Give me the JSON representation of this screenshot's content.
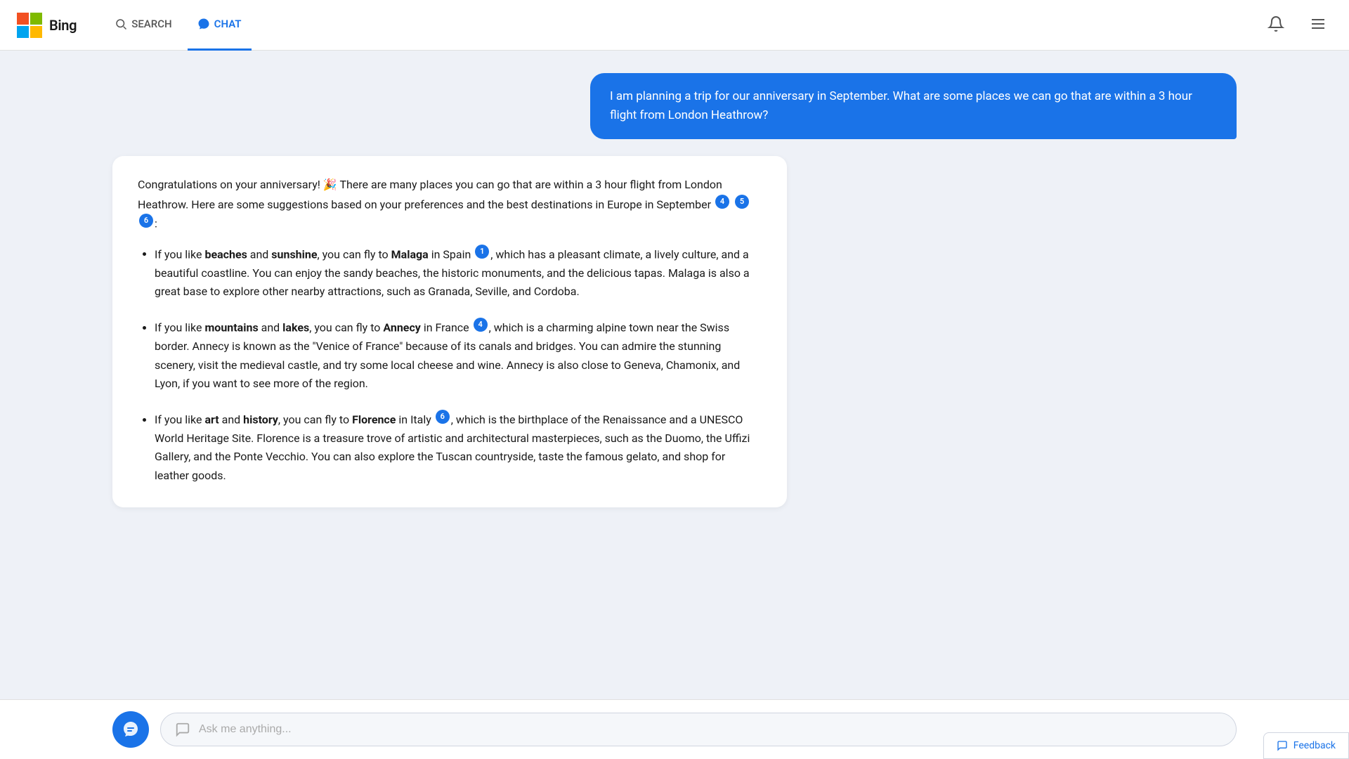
{
  "header": {
    "logo_alt": "Microsoft Bing",
    "brand_text": "Bing",
    "nav": [
      {
        "id": "search",
        "label": "SEARCH",
        "active": false
      },
      {
        "id": "chat",
        "label": "CHAT",
        "active": true
      }
    ]
  },
  "user_message": "I am planning a trip for our anniversary in September. What are some places we can go that are within a 3 hour flight from London Heathrow?",
  "ai_response": {
    "intro": "Congratulations on your anniversary! 🎉 There are many places you can go that are within a 3 hour flight from London Heathrow. Here are some suggestions based on your preferences and the best destinations in Europe in September",
    "intro_citations": [
      "4",
      "5",
      "6"
    ],
    "items": [
      {
        "text_before_bold": "If you like ",
        "bold1": "beaches",
        "text_between": " and ",
        "bold2": "sunshine",
        "text_after": ", you can fly to ",
        "bold3": "Malaga",
        "text_location": " in Spain",
        "citation": "1",
        "rest": ", which has a pleasant climate, a lively culture, and a beautiful coastline. You can enjoy the sandy beaches, the historic monuments, and the delicious tapas. Malaga is also a great base to explore other nearby attractions, such as Granada, Seville, and Cordoba."
      },
      {
        "text_before_bold": "If you like ",
        "bold1": "mountains",
        "text_between": " and ",
        "bold2": "lakes",
        "text_after": ", you can fly to ",
        "bold3": "Annecy",
        "text_location": " in France",
        "citation": "4",
        "rest": ", which is a charming alpine town near the Swiss border. Annecy is known as the “Venice of France” because of its canals and bridges. You can admire the stunning scenery, visit the medieval castle, and try some local cheese and wine. Annecy is also close to Geneva, Chamonix, and Lyon, if you want to see more of the region."
      },
      {
        "text_before_bold": "If you like ",
        "bold1": "art",
        "text_between": " and ",
        "bold2": "history",
        "text_after": ", you can fly to ",
        "bold3": "Florence",
        "text_location": " in Italy",
        "citation": "6",
        "rest": ", which is the birthplace of the Renaissance and a UNESCO World Heritage Site. Florence is a treasure trove of artistic and architectural masterpieces, such as the Duomo, the Uffizi Gallery, and the Ponte Vecchio. You can also explore the Tuscan countryside, taste the famous gelato, and shop for leather goods."
      }
    ]
  },
  "input": {
    "placeholder": "Ask me anything..."
  },
  "feedback": {
    "label": "Feedback"
  }
}
